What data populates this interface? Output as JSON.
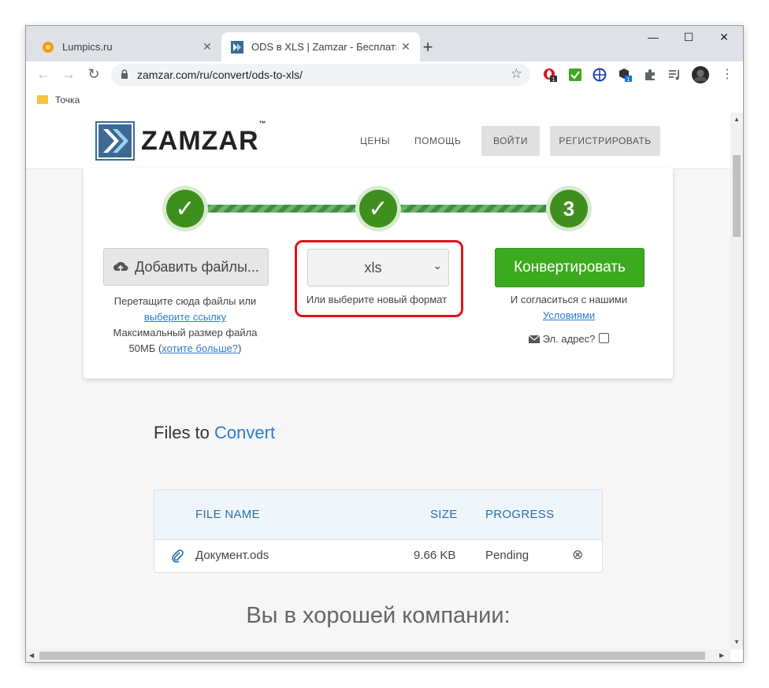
{
  "browser": {
    "tabs": [
      {
        "title": "Lumpics.ru",
        "close": "✕"
      },
      {
        "title": "ODS в XLS | Zamzar - Бесплатная",
        "close": "✕"
      }
    ],
    "new_tab": "+",
    "window_controls": {
      "minimize": "—",
      "maximize": "☐",
      "close": "✕"
    },
    "nav": {
      "back": "←",
      "forward": "→",
      "reload": "↻"
    },
    "url": "zamzar.com/ru/convert/ods-to-xls/",
    "bookmark_star": "☆",
    "extensions": [
      "opera-extension-icon",
      "checkmark-extension-icon",
      "vpn-extension-icon",
      "package-extension-icon",
      "puzzle-extensions-icon",
      "media-playlist-icon",
      "profile-avatar"
    ],
    "extension_badges": {
      "opera": "1",
      "package": "1"
    },
    "menu": "⋮",
    "bookmarks": [
      {
        "label": "Точка"
      }
    ]
  },
  "site": {
    "brand": "ZAMZAR",
    "trademark": "™",
    "nav": {
      "prices": "ЦЕНЫ",
      "help": "ПОМОЩЬ",
      "login": "ВОЙТИ",
      "register": "РЕГИСТРИРОВАТЬ"
    }
  },
  "converter": {
    "steps": [
      {
        "label": "✓",
        "state": "done"
      },
      {
        "label": "✓",
        "state": "done"
      },
      {
        "label": "3",
        "state": "current"
      }
    ],
    "add_files": {
      "label": "Добавить файлы...",
      "hint_line1": "Перетащите сюда файлы или",
      "hint_link": "выберите ссылку",
      "hint_line2": "Максимальный размер файла",
      "hint_line3_prefix": "50МБ (",
      "hint_more_link": "хотите больше?",
      "hint_line3_suffix": ")"
    },
    "format": {
      "selected": "xls",
      "chevron": "⌄",
      "caption": "Или выберите новый формат"
    },
    "convert": {
      "label": "Конвертировать",
      "agree": "И согласиться с нашими",
      "terms_link": "Условиями",
      "email_label": "Эл. адрес?"
    }
  },
  "files": {
    "title_part1": "Files to ",
    "title_part2": "Convert",
    "columns": {
      "name": "FILE NAME",
      "size": "SIZE",
      "progress": "PROGRESS"
    },
    "rows": [
      {
        "name": "Документ.ods",
        "size": "9.66 KB",
        "progress": "Pending",
        "remove": "⊗"
      }
    ]
  },
  "tagline": "Вы в хорошей компании:",
  "colors": {
    "accent_blue": "#2a7bd0",
    "convert_green": "#3caa1e",
    "step_green": "#3f8f1f",
    "highlight_red": "#e0131a"
  }
}
